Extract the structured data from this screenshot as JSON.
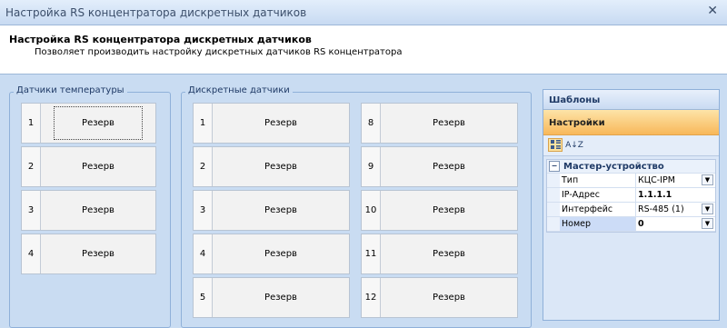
{
  "window": {
    "title": "Настройка RS концентратора дискретных датчиков",
    "close": "✕"
  },
  "header": {
    "title": "Настройка RS концентратора дискретных датчиков",
    "subtitle": "Позволяет производить настройку дискретных датчиков RS концентратора"
  },
  "temp_group": {
    "legend": "Датчики температуры",
    "items": [
      {
        "num": "1",
        "label": "Резерв"
      },
      {
        "num": "2",
        "label": "Резерв"
      },
      {
        "num": "3",
        "label": "Резерв"
      },
      {
        "num": "4",
        "label": "Резерв"
      }
    ]
  },
  "discrete_group": {
    "legend": "Дискретные датчики",
    "left": [
      {
        "num": "1",
        "label": "Резерв"
      },
      {
        "num": "2",
        "label": "Резерв"
      },
      {
        "num": "3",
        "label": "Резерв"
      },
      {
        "num": "4",
        "label": "Резерв"
      },
      {
        "num": "5",
        "label": "Резерв"
      }
    ],
    "right": [
      {
        "num": "8",
        "label": "Резерв"
      },
      {
        "num": "9",
        "label": "Резерв"
      },
      {
        "num": "10",
        "label": "Резерв"
      },
      {
        "num": "11",
        "label": "Резерв"
      },
      {
        "num": "12",
        "label": "Резерв"
      }
    ]
  },
  "right_panel": {
    "tab_templates": "Шаблоны",
    "tab_settings": "Настройки",
    "toolbar": {
      "categorized_icon": "categorized-icon",
      "sort_icon_text": "A↓Z"
    },
    "category": {
      "toggle": "−",
      "title": "Мастер-устройство"
    },
    "properties": [
      {
        "name": "Тип",
        "value": "КЦС-IPM",
        "bold": false,
        "dropdown": true
      },
      {
        "name": "IP-Адрес",
        "value": "1.1.1.1",
        "bold": true,
        "dropdown": false
      },
      {
        "name": "Интерфейс",
        "value": "RS-485 (1)",
        "bold": false,
        "dropdown": true
      },
      {
        "name": "Номер",
        "value": "0",
        "bold": true,
        "dropdown": true
      }
    ]
  },
  "colors": {
    "background": "#c9dcf2",
    "accent_tab": "#f8b85a",
    "border": "#8fb0d9"
  }
}
